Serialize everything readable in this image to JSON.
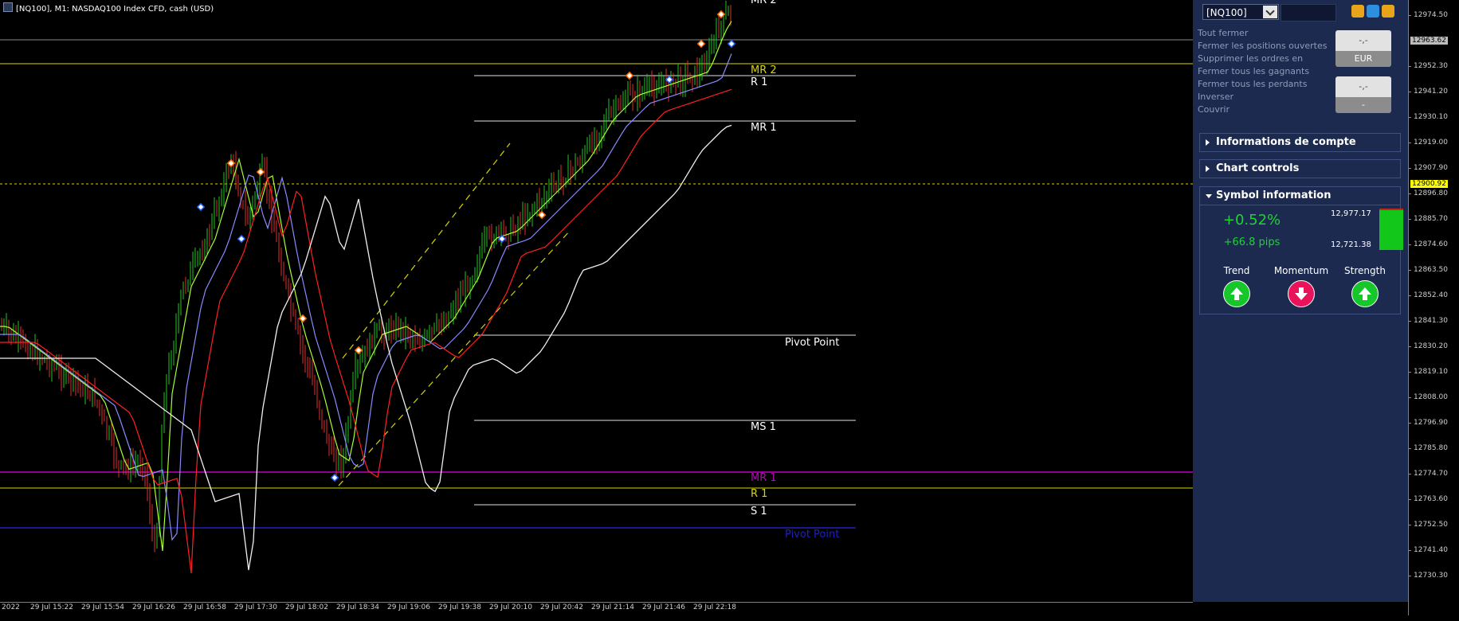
{
  "chart_title": "[NQ100], M1:  NASDAQ100 Index CFD, cash (USD)",
  "price_ticks": [
    "12974.50",
    "12952.30",
    "12941.20",
    "12930.10",
    "12919.00",
    "12907.90",
    "12896.80",
    "12885.70",
    "12874.60",
    "12863.50",
    "12852.40",
    "12841.30",
    "12830.20",
    "12819.10",
    "12808.00",
    "12796.90",
    "12785.80",
    "12774.70",
    "12763.60",
    "12752.50",
    "12741.40",
    "12730.30"
  ],
  "price_badges": {
    "upper": "12963.62",
    "current": "12900.92"
  },
  "time_ticks": [
    "2022",
    "29 Jul 15:22",
    "29 Jul 15:54",
    "29 Jul 16:26",
    "29 Jul 16:58",
    "29 Jul 17:30",
    "29 Jul 18:02",
    "29 Jul 18:34",
    "29 Jul 19:06",
    "29 Jul 19:38",
    "29 Jul 20:10",
    "29 Jul 20:42",
    "29 Jul 21:14",
    "29 Jul 21:46",
    "29 Jul 22:18"
  ],
  "level_labels": {
    "mr2_top": "MR 2",
    "mr2": "MR 2",
    "r1": "R 1",
    "mr1": "MR 1",
    "pivot": "Pivot Point",
    "ms1": "MS 1",
    "mr1_daily": "MR 1",
    "r1_daily": "R 1",
    "s1": "S 1",
    "pivot_daily": "Pivot Point"
  },
  "side_panel": {
    "symbol": "[NQ100]",
    "volume_value": "",
    "close_actions": [
      "Tout fermer",
      "Fermer les positions ouvertes",
      "Supprimer les ordres en",
      "Fermer tous les gagnants",
      "Fermer tous les perdants",
      "Inverser",
      "Couvrir"
    ],
    "price_button_1": {
      "value": "-,-",
      "currency": "EUR"
    },
    "price_button_2": {
      "value": "-,-",
      "sub": "-"
    },
    "sections": {
      "account": "Informations de compte",
      "chart": "Chart controls",
      "symbol": "Symbol information"
    },
    "symbol_info": {
      "pct_change": "+0.52%",
      "pips_change": "+66.8 pips",
      "range_high": "12,977.17",
      "range_low": "12,721.38",
      "indicators": [
        {
          "label": "Trend",
          "direction": "up",
          "color": "#16c62a"
        },
        {
          "label": "Momentum",
          "direction": "down",
          "color": "#e8135a"
        },
        {
          "label": "Strength",
          "direction": "up",
          "color": "#16c62a"
        }
      ]
    }
  },
  "colors": {
    "bg": "#000000",
    "panel": "#1c2a4f",
    "up_candle": "#1fc91f",
    "down_candle": "#e03030",
    "mr_line": "#c000c0",
    "yellow": "#d6d600",
    "blue": "#2020c0"
  }
}
